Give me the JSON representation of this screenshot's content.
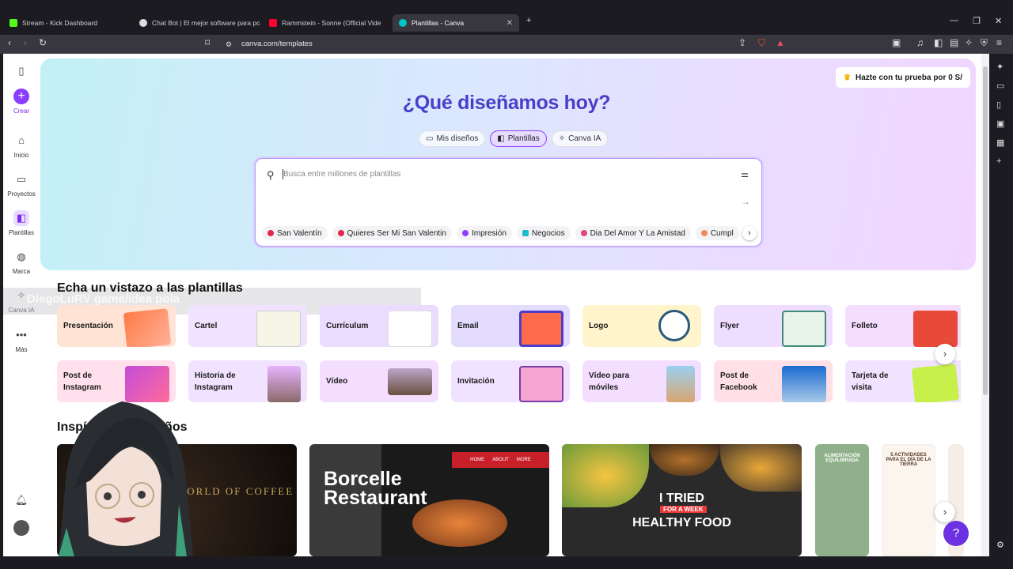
{
  "tabs": [
    {
      "title": "Stream - Kick Dashboard",
      "color": "#53fc18"
    },
    {
      "title": "Chat Bot | El mejor software para pot",
      "color": "#dddddd"
    },
    {
      "title": "Rammstein - Sonne (Official Vide",
      "color": "#ff0033"
    },
    {
      "title": "Plantillas - Canva",
      "color": "#00c4cc"
    }
  ],
  "address": "canva.com/templates",
  "nav": {
    "create": "Crear",
    "home": "Inicio",
    "projects": "Proyectos",
    "templates": "Plantillas",
    "brand": "Marca",
    "canva_ai": "Canva IA",
    "more": "Más"
  },
  "hero": {
    "trial": "Hazte con tu prueba por 0 S/",
    "title": "¿Qué diseñamos hoy?",
    "pills": [
      "Mis diseños",
      "Plantillas",
      "Canva IA"
    ],
    "search_placeholder": "Busca entre millones de plantillas",
    "chips": [
      "San Valentín",
      "Quieres Ser Mi San Valentin",
      "Impresión",
      "Negocios",
      "Dia Del Amor Y La Amistad",
      "Cumpl"
    ]
  },
  "watermark": "DiegoLuRV  game/idea pola",
  "section_templates": "Echa un vistazo a las plantillas",
  "row1": [
    "Presentación",
    "Cartel",
    "Currículum",
    "Email",
    "Logo",
    "Flyer",
    "Folleto"
  ],
  "row2": [
    "Post de Instagram",
    "Historia de Instagram",
    "Vídeo",
    "Invitación",
    "Vídeo para móviles",
    "Post de Facebook",
    "Tarjeta de visita"
  ],
  "section_inspo": "Inspírate con diseños",
  "inspo": {
    "coffee": "WORLD OF COFFEE",
    "restaurant_title": "Borcelle Restaurant",
    "restaurant_nav": [
      "HOME",
      "ABOUT",
      "MORE"
    ],
    "food_line1": "I TRIED",
    "food_line2": "FOR A WEEK",
    "food_line3": "HEALTHY FOOD",
    "poster1": "ALIMENTACIÓN EQUILIBRADA",
    "poster2": "5 ACTIVIDADES PARA EL DÍA DE LA TIERRA"
  },
  "colors": {
    "accent": "#8b3dff",
    "title": "#4a3ec8"
  }
}
